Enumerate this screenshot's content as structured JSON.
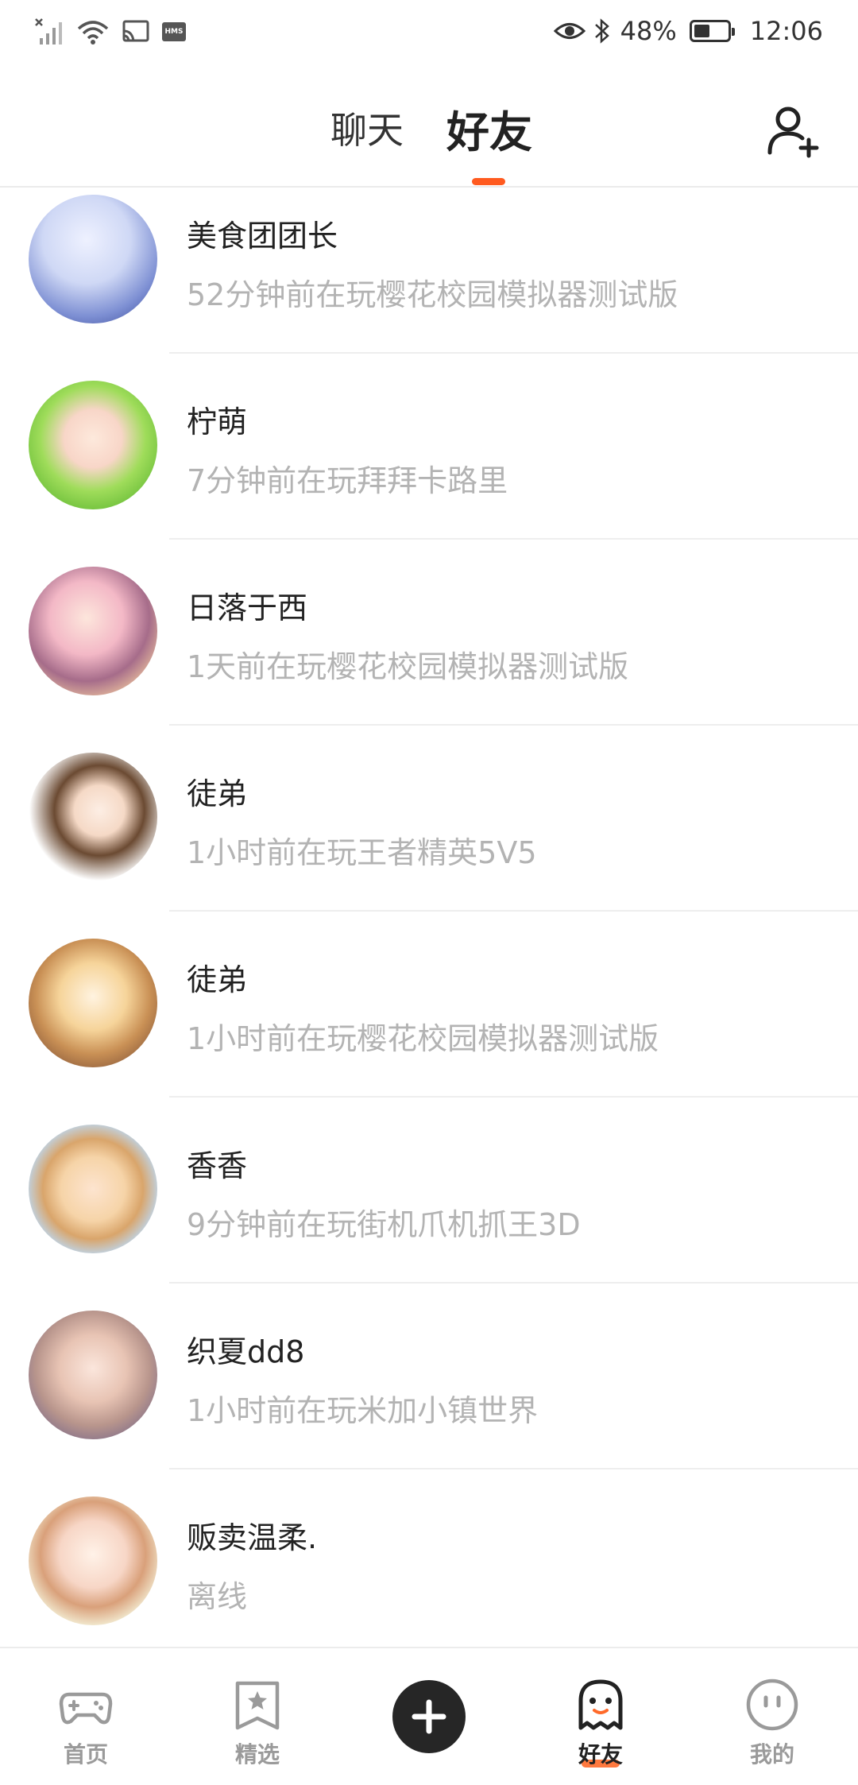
{
  "status_bar": {
    "hms_label": "HMS",
    "battery_percent": "48%",
    "battery_level": 0.48,
    "time": "12:06"
  },
  "header": {
    "tabs": [
      {
        "label": "聊天",
        "active": false
      },
      {
        "label": "好友",
        "active": true
      }
    ],
    "accent_color": "#ff5a1f",
    "add_friend_icon": "add-user-icon"
  },
  "friends": [
    {
      "name": "美食团团长",
      "status": "52分钟前在玩樱花校园模拟器测试版",
      "avatar_colors": [
        "#cfd8f5",
        "#4a5fb0"
      ]
    },
    {
      "name": "柠萌",
      "status": "7分钟前在玩拜拜卡路里",
      "avatar_colors": [
        "#b7e27a",
        "#f3c9d6"
      ]
    },
    {
      "name": "日落于西",
      "status": "1天前在玩樱花校园模拟器测试版",
      "avatar_colors": [
        "#f2b3c8",
        "#8a5a3a"
      ]
    },
    {
      "name": "徒弟",
      "status": "1小时前在玩王者精英5V5",
      "avatar_colors": [
        "#ffffff",
        "#6b4a32"
      ]
    },
    {
      "name": "徒弟",
      "status": "1小时前在玩樱花校园模拟器测试版",
      "avatar_colors": [
        "#f3dcc0",
        "#9c6b3c"
      ]
    },
    {
      "name": "香香",
      "status": "9分钟前在玩街机爪机抓王3D",
      "avatar_colors": [
        "#bcd9f4",
        "#f6d4a8"
      ]
    },
    {
      "name": "织夏dd8",
      "status": "1小时前在玩米加小镇世界",
      "avatar_colors": [
        "#c9b5c3",
        "#6a5a7a"
      ]
    },
    {
      "name": "贩卖温柔.",
      "status": "离线",
      "avatar_colors": [
        "#f6ecd6",
        "#c98a6a"
      ]
    }
  ],
  "bottom_nav": {
    "items": [
      {
        "label": "首页",
        "icon": "gamepad-icon",
        "active": false
      },
      {
        "label": "精选",
        "icon": "bookmark-star-icon",
        "active": false
      },
      {
        "label": "",
        "icon": "plus-icon",
        "active": false
      },
      {
        "label": "好友",
        "icon": "ghost-icon",
        "active": true
      },
      {
        "label": "我的",
        "icon": "face-icon",
        "active": false
      }
    ]
  }
}
